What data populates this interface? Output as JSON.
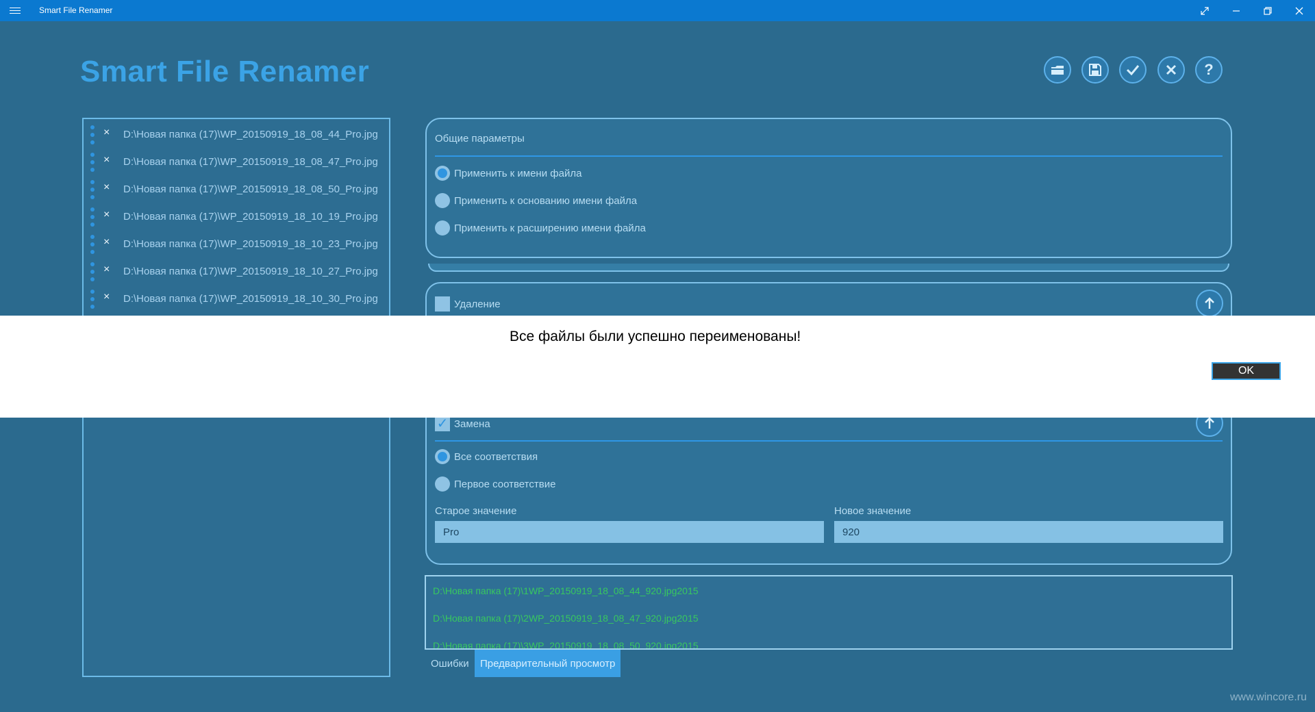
{
  "window": {
    "title": "Smart File Renamer",
    "icons": {
      "menu": "hamburger-icon",
      "fullscreen": "expand-icon",
      "minimize": "minimize-icon",
      "restore": "restore-icon",
      "close": "close-icon"
    }
  },
  "header": {
    "app_title": "Smart File Renamer",
    "toolbar": [
      {
        "name": "open-folder",
        "icon": "folder-icon"
      },
      {
        "name": "save",
        "icon": "save-icon"
      },
      {
        "name": "apply",
        "icon": "check-icon"
      },
      {
        "name": "clear",
        "icon": "close-icon"
      },
      {
        "name": "help",
        "icon": "help-icon"
      }
    ]
  },
  "files": [
    "D:\\Новая папка (17)\\WP_20150919_18_08_44_Pro.jpg",
    "D:\\Новая папка (17)\\WP_20150919_18_08_47_Pro.jpg",
    "D:\\Новая папка (17)\\WP_20150919_18_08_50_Pro.jpg",
    "D:\\Новая папка (17)\\WP_20150919_18_10_19_Pro.jpg",
    "D:\\Новая папка (17)\\WP_20150919_18_10_23_Pro.jpg",
    "D:\\Новая папка (17)\\WP_20150919_18_10_27_Pro.jpg",
    "D:\\Новая папка (17)\\WP_20150919_18_10_30_Pro.jpg"
  ],
  "general": {
    "title": "Общие параметры",
    "options": [
      "Применить к имени файла",
      "Применить к основанию имени файла",
      "Применить к расширению имени файла"
    ],
    "selected": 0
  },
  "delete_panel": {
    "label": "Удаление",
    "checked": false
  },
  "replace_panel": {
    "label": "Замена",
    "checked": true,
    "options": [
      "Все соответствия",
      "Первое соответствие"
    ],
    "selected": 0,
    "old_label": "Старое значение",
    "old_value": "Pro",
    "new_label": "Новое значение",
    "new_value": "920"
  },
  "preview_lines": [
    "D:\\Новая папка (17)\\1WP_20150919_18_08_44_920.jpg2015",
    "D:\\Новая папка (17)\\2WP_20150919_18_08_47_920.jpg2015",
    "D:\\Новая папка (17)\\3WP_20150919_18_08_50_920.jpg2015"
  ],
  "tabs": {
    "errors": "Ошибки",
    "preview": "Предварительный просмотр"
  },
  "dialog": {
    "message": "Все файлы были успешно переименованы!",
    "ok": "OK"
  },
  "watermark": "www.wincore.ru",
  "colors": {
    "background": "#2b6a8e",
    "accent": "#3ba3e6",
    "titlebar": "#0b79d0",
    "preview_text": "#38c85f"
  }
}
